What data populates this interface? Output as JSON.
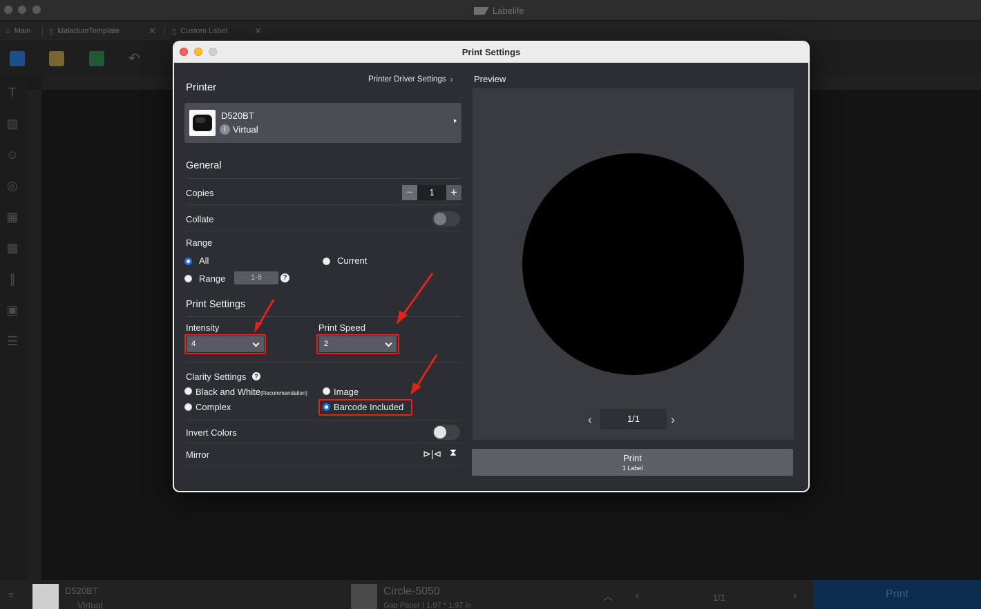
{
  "app": {
    "title": "Labelife",
    "tabs": [
      "Main",
      "MaladumTemplate",
      "Custom Label"
    ]
  },
  "statusbar": {
    "printer_name": "D520BT",
    "printer_status": "Virtual",
    "label_name": "Circle-5050",
    "label_info": "Gap Paper | 1.97 * 1.97 in",
    "page": "1/1",
    "print_label": "Print"
  },
  "dialog": {
    "title": "Print Settings",
    "printer_section": "Printer",
    "driver_settings_link": "Printer Driver Settings",
    "printer": {
      "name": "D520BT",
      "status": "Virtual"
    },
    "general_section": "General",
    "copies_label": "Copies",
    "copies_value": "1",
    "collate_label": "Collate",
    "collate_on": false,
    "range_section": "Range",
    "range_options": {
      "all": "All",
      "current": "Current",
      "range": "Range"
    },
    "range_selected": "All",
    "range_placeholder": "1-6",
    "print_settings_section": "Print Settings",
    "intensity_label": "Intensity",
    "intensity_value": "4",
    "print_speed_label": "Print Speed",
    "print_speed_value": "2",
    "clarity_section": "Clarity Settings",
    "clarity_options": {
      "bw": "Black and White",
      "bw_note": "(Recommendation)",
      "image": "Image",
      "complex": "Complex",
      "barcode": "Barcode Included"
    },
    "clarity_selected": "Barcode Included",
    "invert_label": "Invert Colors",
    "invert_on": false,
    "mirror_label": "Mirror",
    "preview_title": "Preview",
    "preview_page": "1/1",
    "print_button": "Print",
    "print_count": "1 Label"
  },
  "colors": {
    "highlight": "#e0231c",
    "radio_selected": "#1a73e8",
    "dialog_bg": "#2d2e33"
  }
}
